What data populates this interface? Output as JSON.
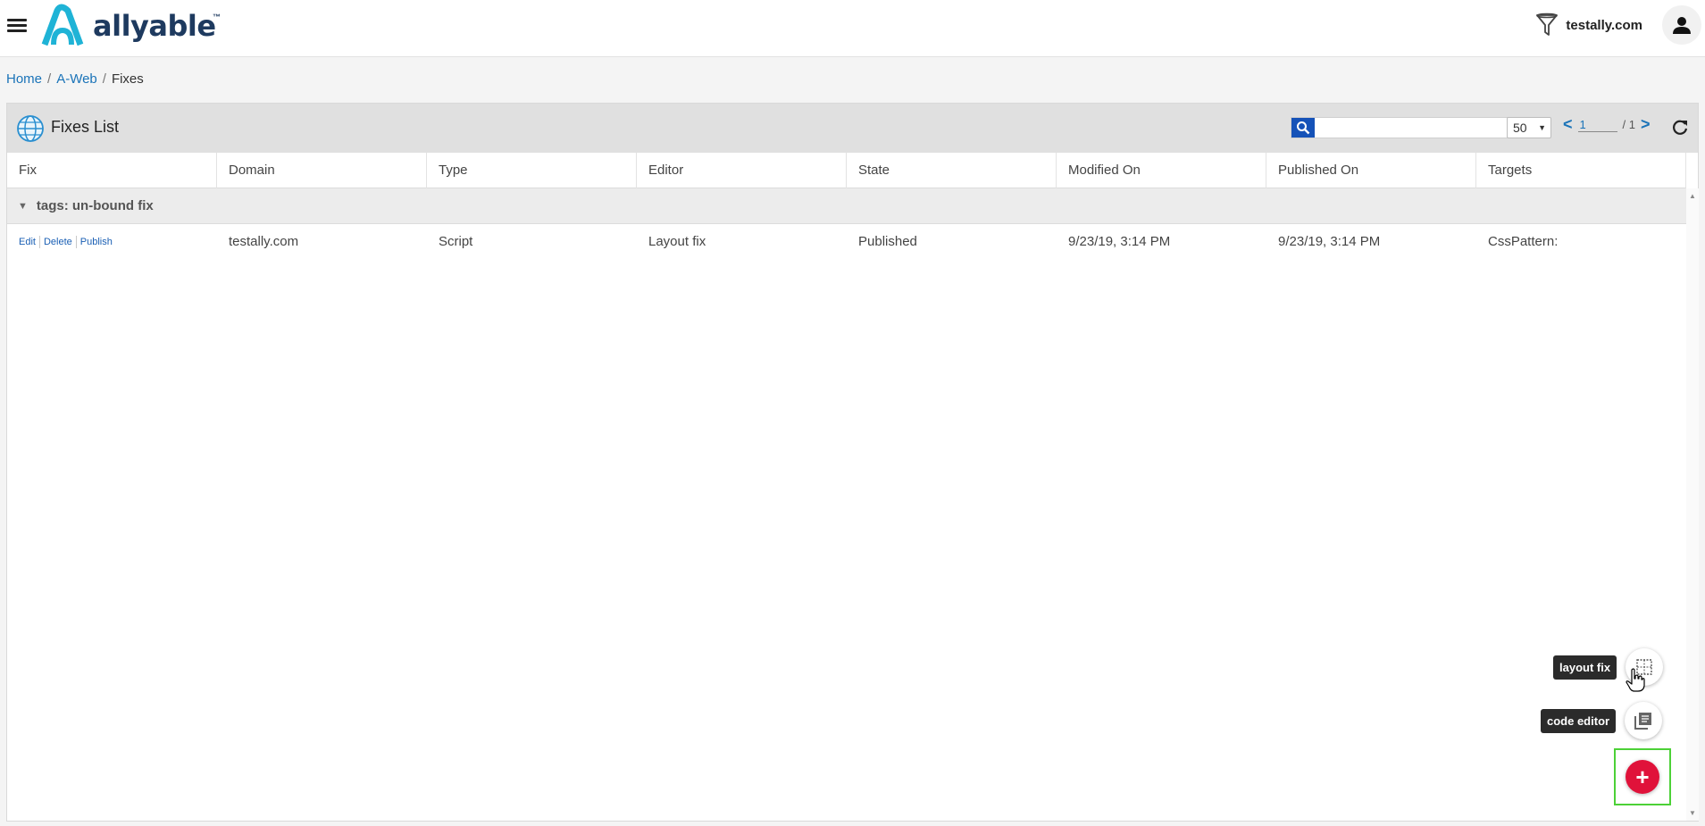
{
  "header": {
    "logo_text": "allyable",
    "logo_tm": "™",
    "domain": "testally.com"
  },
  "breadcrumb": {
    "items": [
      "Home",
      "A-Web"
    ],
    "separator": "/",
    "current": "Fixes"
  },
  "panel": {
    "title": "Fixes List",
    "search_placeholder": "",
    "page_size": "50",
    "prev": "<",
    "next": ">",
    "page_value": "1",
    "page_total": "/ 1"
  },
  "table": {
    "columns": [
      "Fix",
      "Domain",
      "Type",
      "Editor",
      "State",
      "Modified On",
      "Published On",
      "Targets"
    ],
    "group_label": "tags: un-bound fix",
    "rows": [
      {
        "actions": [
          "Edit",
          "Delete",
          "Publish"
        ],
        "domain": "testally.com",
        "type": "Script",
        "editor": "Layout fix",
        "state": "Published",
        "modified_on": "9/23/19, 3:14 PM",
        "published_on": "9/23/19, 3:14 PM",
        "targets": "CssPattern:"
      }
    ]
  },
  "fab": {
    "layout_fix_tooltip": "layout fix",
    "code_editor_tooltip": "code editor",
    "main_label": "+"
  },
  "colors": {
    "accent_blue": "#1a73b8",
    "search_blue": "#1552b8",
    "fab_red": "#e0123a",
    "focus_green": "#4cd137"
  }
}
